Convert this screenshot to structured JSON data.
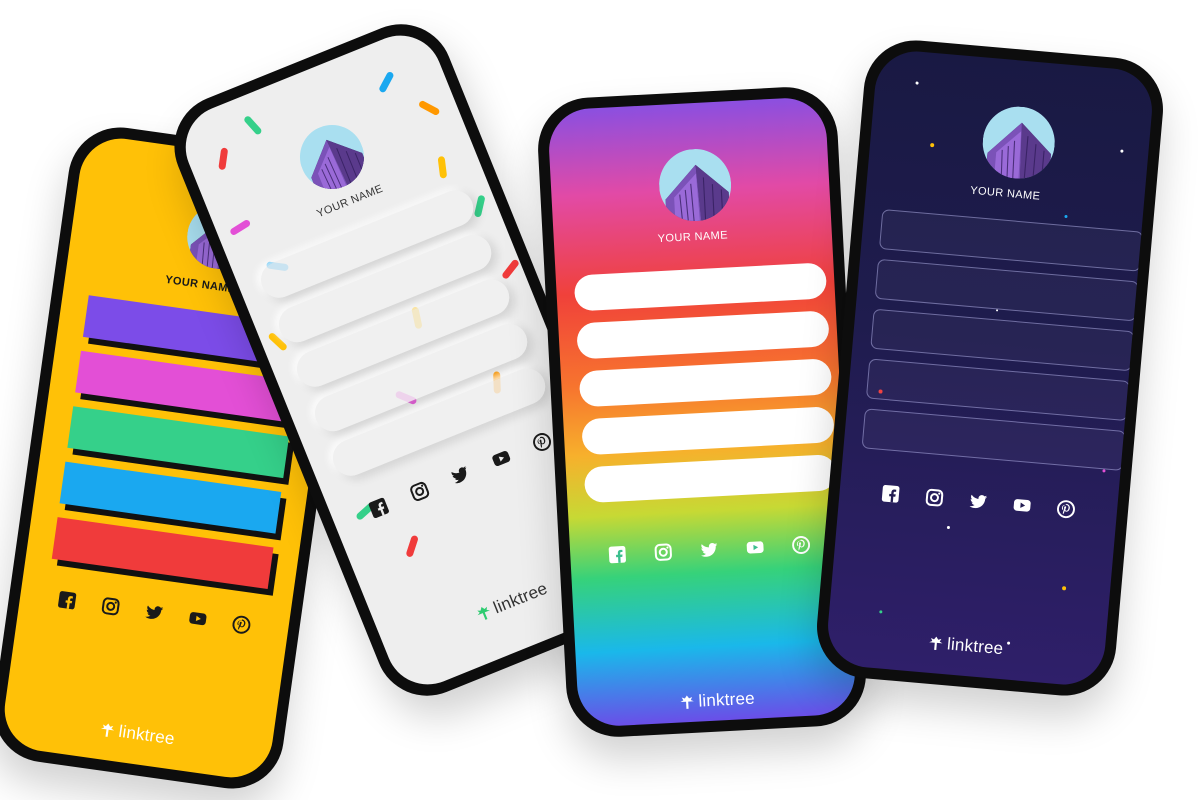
{
  "colors": {
    "yellow_bg": "#ffc107",
    "purple_bar": "#7c4ce8",
    "pink_bar": "#e34fd6",
    "green_bar": "#35d08a",
    "blue_bar": "#1aa8f0",
    "red_bar": "#f03b3b",
    "light_bg": "#eeeeee",
    "space_bg": "#221a4d",
    "brand_green": "#2ecc71"
  },
  "phones": [
    {
      "theme": "yellow",
      "profile_name": "YOUR NAME",
      "brand": "linktree",
      "link_count": 5
    },
    {
      "theme": "confetti",
      "profile_name": "YOUR NAME",
      "brand": "linktree",
      "link_count": 5
    },
    {
      "theme": "gradient",
      "profile_name": "YOUR NAME",
      "brand": "linktree",
      "link_count": 5
    },
    {
      "theme": "space",
      "profile_name": "YOUR NAME",
      "brand": "linktree",
      "link_count": 5
    }
  ],
  "social_icons": [
    "facebook-icon",
    "instagram-icon",
    "twitter-icon",
    "youtube-icon",
    "pinterest-icon"
  ]
}
